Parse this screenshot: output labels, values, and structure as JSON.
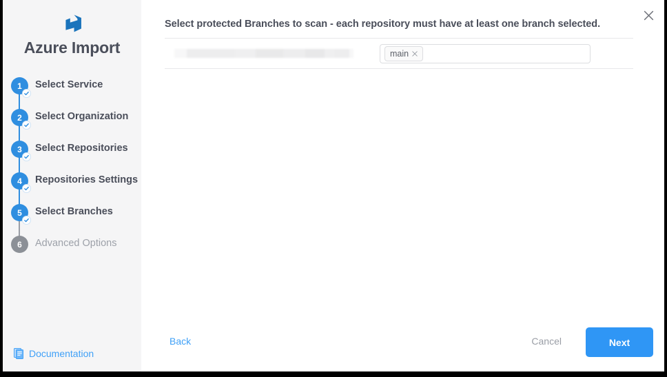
{
  "window": {
    "close_icon": "close-icon"
  },
  "sidebar": {
    "logo_icon": "azure-devops-logo-icon",
    "brand_title": "Azure Import",
    "steps": [
      {
        "number": "1",
        "label": "Select Service",
        "state": "complete"
      },
      {
        "number": "2",
        "label": "Select Organization",
        "state": "complete"
      },
      {
        "number": "3",
        "label": "Select Repositories",
        "state": "complete"
      },
      {
        "number": "4",
        "label": "Repositories Settings",
        "state": "complete"
      },
      {
        "number": "5",
        "label": "Select Branches",
        "state": "complete"
      },
      {
        "number": "6",
        "label": "Advanced Options",
        "state": "inactive"
      }
    ],
    "documentation": {
      "icon": "document-icon",
      "label": "Documentation"
    }
  },
  "main": {
    "title": "Select protected Branches to scan - each repository must have at least one branch selected.",
    "repositories": [
      {
        "name": "",
        "name_redacted": true,
        "branches": [
          {
            "label": "main",
            "remove_icon": "close-icon"
          }
        ],
        "input_placeholder": ""
      }
    ]
  },
  "footer": {
    "back_label": "Back",
    "cancel_label": "Cancel",
    "next_label": "Next"
  },
  "colors": {
    "accent_blue": "#2f8ee0",
    "button_blue": "#2f96f5",
    "link_blue": "#3fa0f7",
    "inactive_gray": "#8c9097",
    "text_dark": "#4a4e5a",
    "sidebar_bg": "#f5f5f6",
    "frame_black": "#000000"
  }
}
